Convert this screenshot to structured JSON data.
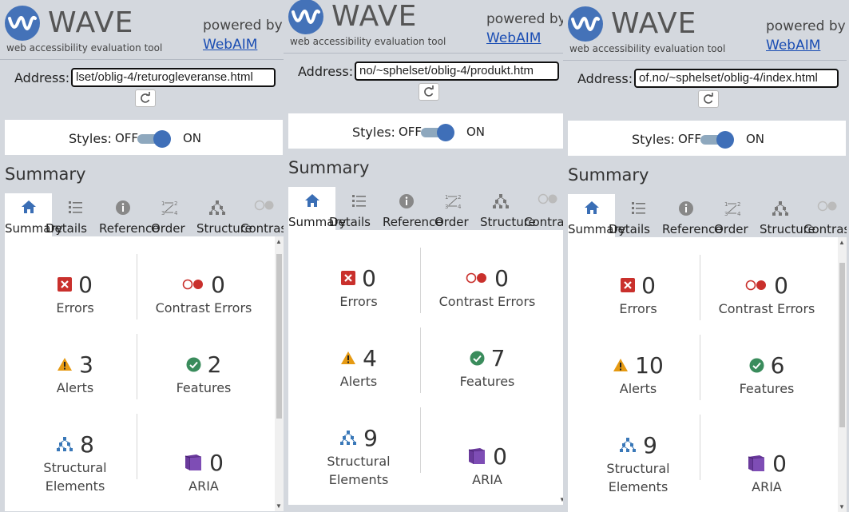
{
  "header": {
    "title": "WAVE",
    "subtitle": "web accessibility evaluation tool",
    "powered_by": "powered by",
    "webaim_link": "WebAIM"
  },
  "address_label": "Address:",
  "styles": {
    "label": "Styles:",
    "off": "OFF",
    "on": "ON"
  },
  "summary_heading": "Summary",
  "tabs": [
    "Summary",
    "Details",
    "Reference",
    "Order",
    "Structure",
    "Contrast"
  ],
  "labels": {
    "errors": "Errors",
    "contrast_errors": "Contrast Errors",
    "alerts": "Alerts",
    "features": "Features",
    "structural_1": "Structural",
    "structural_2": "Elements",
    "aria": "ARIA"
  },
  "panels": [
    {
      "url": "lset/oblig-4/returogleveranse.html",
      "errors": "0",
      "contrast_errors": "0",
      "alerts": "3",
      "features": "2",
      "structural": "8",
      "aria": "0"
    },
    {
      "url": "no/~sphelset/oblig-4/produkt.htm",
      "errors": "0",
      "contrast_errors": "0",
      "alerts": "4",
      "features": "7",
      "structural": "9",
      "aria": "0"
    },
    {
      "url": "of.no/~sphelset/oblig-4/index.html",
      "errors": "0",
      "contrast_errors": "0",
      "alerts": "10",
      "features": "6",
      "structural": "9",
      "aria": "0"
    }
  ],
  "colors": {
    "brand": "#4472b8",
    "error": "#c9302c",
    "alert": "#e69a12",
    "feature": "#3a8c5c",
    "structure": "#3a78b8",
    "aria": "#6a3a9c"
  }
}
